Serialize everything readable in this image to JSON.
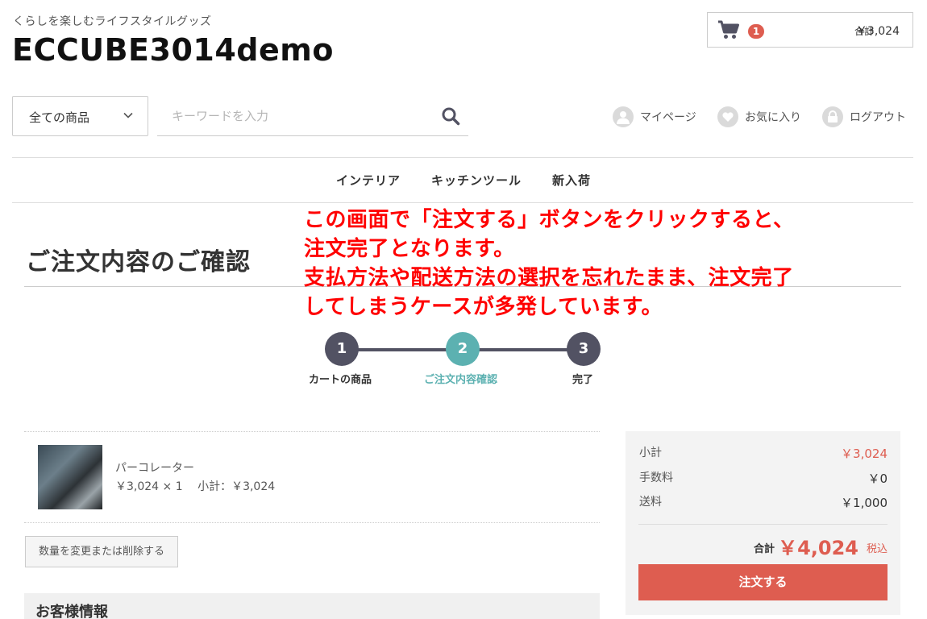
{
  "header": {
    "tagline": "くらしを楽しむライフスタイルグッズ",
    "shop_name": "ECCUBE3014demo",
    "cart": {
      "count": "1",
      "total_label": "合計",
      "total_value": "￥3,024",
      "icon": "cart-icon"
    }
  },
  "search": {
    "category_selected": "全ての商品",
    "placeholder": "キーワードを入力"
  },
  "utility_links": [
    {
      "label": "マイページ",
      "icon": "user-icon"
    },
    {
      "label": "お気に入り",
      "icon": "heart-icon"
    },
    {
      "label": "ログアウト",
      "icon": "lock-icon"
    }
  ],
  "nav": {
    "items": [
      "インテリア",
      "キッチンツール",
      "新入荷"
    ]
  },
  "page": {
    "title": "ご注文内容のご確認"
  },
  "annotation": {
    "lines": [
      "この画面で「注文する」ボタンをクリックすると、",
      "注文完了となります。",
      "支払方法や配送方法の選択を忘れたまま、注文完了",
      "してしまうケースが多発しています。"
    ],
    "color": "#ff0000"
  },
  "steps": [
    {
      "number": "1",
      "label": "カートの商品",
      "state": "done"
    },
    {
      "number": "2",
      "label": "ご注文内容確認",
      "state": "active"
    },
    {
      "number": "3",
      "label": "完了",
      "state": "pending"
    }
  ],
  "items": [
    {
      "name": "パーコレーター",
      "detail": "￥3,024 × 1　 小計：￥3,024"
    }
  ],
  "change_button": "数量を変更または削除する",
  "customer_section_title": "お客様情報",
  "summary": {
    "subtotal_label": "小計",
    "subtotal_value": "￥3,024",
    "fee_label": "手数料",
    "fee_value": "￥0",
    "shipping_label": "送料",
    "shipping_value": "￥1,000",
    "total_label": "合計",
    "total_value": "￥4,024",
    "tax_label": "税込",
    "order_button": "注文する"
  },
  "colors": {
    "accent": "#de5d50",
    "step_active": "#5cb1b1",
    "step_default": "#525263"
  }
}
